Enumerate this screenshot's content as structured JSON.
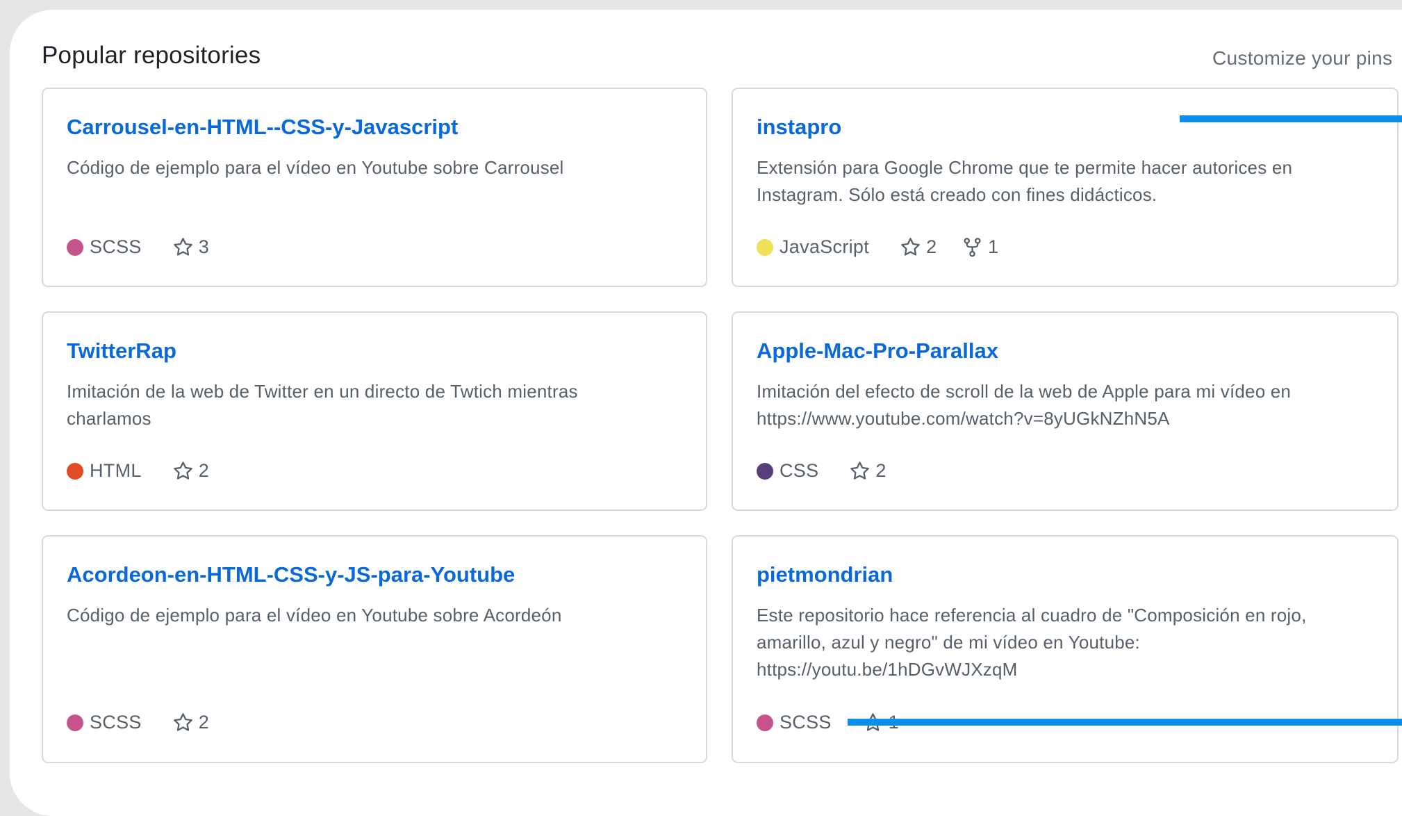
{
  "section": {
    "title": "Popular repositories",
    "customize_label": "Customize your pins"
  },
  "repos": [
    {
      "name": "Carrousel-en-HTML--CSS-y-Javascript",
      "description": "Código de ejemplo para el vídeo en Youtube sobre Carrousel",
      "language": "SCSS",
      "language_color": "#c6538c",
      "stars": "3",
      "forks": null
    },
    {
      "name": "instapro",
      "description": "Extensión para Google Chrome que te permite hacer autorices en Instagram. Sólo está creado con fines didácticos.",
      "language": "JavaScript",
      "language_color": "#f1e05a",
      "stars": "2",
      "forks": "1"
    },
    {
      "name": "TwitterRap",
      "description": "Imitación de la web de Twitter en un directo de Twtich mientras charlamos",
      "language": "HTML",
      "language_color": "#e34c26",
      "stars": "2",
      "forks": null
    },
    {
      "name": "Apple-Mac-Pro-Parallax",
      "description": "Imitación del efecto de scroll de la web de Apple para mi vídeo en https://www.youtube.com/watch?v=8yUGkNZhN5A",
      "language": "CSS",
      "language_color": "#563d7c",
      "stars": "2",
      "forks": null
    },
    {
      "name": "Acordeon-en-HTML-CSS-y-JS-para-Youtube",
      "description": "Código de ejemplo para el vídeo en Youtube sobre Acordeón",
      "language": "SCSS",
      "language_color": "#c6538c",
      "stars": "2",
      "forks": null
    },
    {
      "name": "pietmondrian",
      "description": "Este repositorio hace referencia al cuadro de \"Composición en rojo, amarillo, azul y negro\" de mi vídeo en Youtube: https://youtu.be/1hDGvWJXzqM",
      "language": "SCSS",
      "language_color": "#c6538c",
      "stars": "1",
      "forks": null
    }
  ],
  "icons": {
    "star": "star-icon",
    "fork": "repo-forked-icon"
  },
  "colors": {
    "link": "#0969da",
    "muted_text": "#57606a",
    "annotation_line": "#0a90ea"
  }
}
